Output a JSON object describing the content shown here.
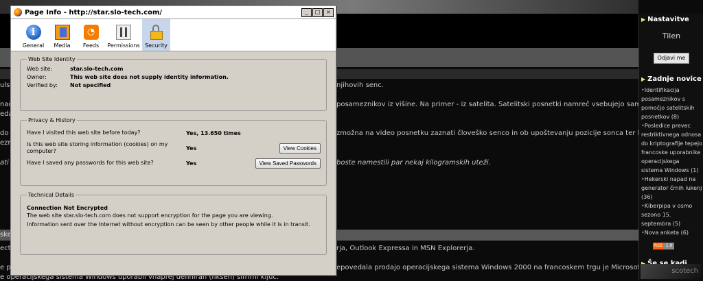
{
  "window": {
    "title": "Page Info - http://star.slo-tech.com/",
    "controls": [
      "_",
      "□",
      "×"
    ]
  },
  "toolbar": {
    "items": [
      {
        "label": "General",
        "icon": "general-info-icon"
      },
      {
        "label": "Media",
        "icon": "media-icon"
      },
      {
        "label": "Feeds",
        "icon": "rss-feed-icon"
      },
      {
        "label": "Permissions",
        "icon": "permissions-icon"
      },
      {
        "label": "Security",
        "icon": "padlock-icon",
        "selected": true
      }
    ]
  },
  "identity": {
    "legend": "Web Site Identity",
    "website_label": "Web site:",
    "website_value": "star.slo-tech.com",
    "owner_label": "Owner:",
    "owner_value": "This web site does not supply identity information.",
    "verified_label": "Verified by:",
    "verified_value": "Not specified"
  },
  "privacy": {
    "legend": "Privacy & History",
    "q1": "Have I visited this web site before today?",
    "a1": "Yes, 13.650 times",
    "q2": "Is this web site storing information (cookies) on my computer?",
    "a2": "Yes",
    "btn_cookies": "View Cookies",
    "q3": "Have I saved any passwords for this web site?",
    "a3": "Yes",
    "btn_passwords": "View Saved Passwords"
  },
  "technical": {
    "legend": "Technical Details",
    "title": "Connection Not Encrypted",
    "line1": "The web site star.slo-tech.com does not support encryption for the page you are viewing.",
    "line2": "Information sent over the Internet without encryption can be seen by other people while it is in transit."
  },
  "background_page": {
    "snippets": {
      "s1": "ulsi",
      "s2": "njihovih senc.",
      "s3": "nač",
      "s4": "posameznikov iz višine. Na primer - iz satelita. Satelitski posnetki namreč vsebujejo samo",
      "s5": "edaj",
      "s6": "do",
      "s7": "zmožna na video posnetku zaznati človeško senco in ob upoštevanju pozicije sonca ter kota",
      "s8": "ezni",
      "s9": "ati",
      "s10": "boste namestili par nekaj kilogramskih uteži.",
      "s11": "ske",
      "s12": "ecte",
      "s13": "rja, Outlook Expressa in MSN Explorerja.",
      "s14": "e p",
      "s15": "epovedala prodajo operacijskega sistema Windows 2000 na francoskem trgu je Microsoft za",
      "s16": "e operacijskega sistema Windows uporabil vnaprej definiran (fiksen) šifrirni ključ."
    },
    "sidebar": {
      "settings_heading": "Nastavitve",
      "username": "Tilen",
      "logout_button": "Odjavi me",
      "news_heading": "Zadnje novice",
      "news": [
        "Identifikacija posameznikov s pomočjo satelitskih posnetkov (8)",
        "Posledice prevec restriktivnega odnosa do kriptografije tepejo francoske uporabnike operacijskega sistema Windows (1)",
        "Hekerski napad na generator črnih lukenj (36)",
        "Kiberpipa v osmo sezono 15. septembra (5)",
        "Nova anketa (6)"
      ],
      "rss_badge": [
        "RSS",
        "1.0"
      ],
      "still_heading": "Še se kadi",
      "logo": "scotech"
    }
  }
}
